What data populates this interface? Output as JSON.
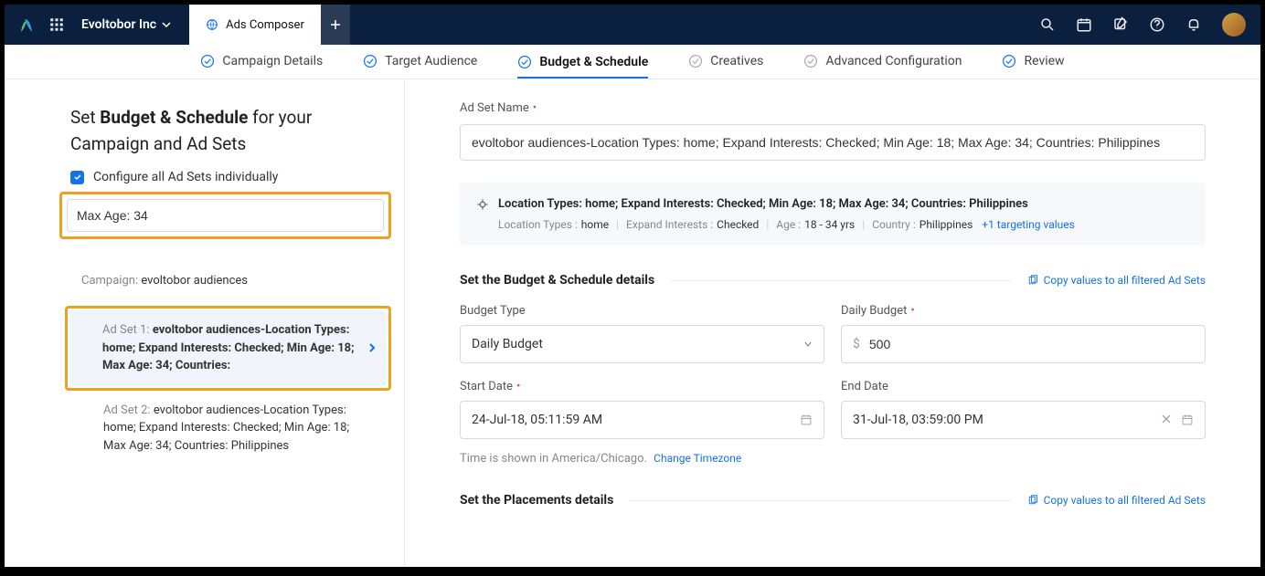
{
  "topnav": {
    "org": "Evoltobor Inc",
    "tab_label": "Ads Composer"
  },
  "steps": [
    "Campaign Details",
    "Target Audience",
    "Budget & Schedule",
    "Creatives",
    "Advanced Configuration",
    "Review"
  ],
  "sidebar": {
    "title_pre": "Set ",
    "title_strong": "Budget & Schedule",
    "title_post": " for your Campaign and Ad Sets",
    "configure_label": "Configure all Ad Sets individually",
    "filter_value": "Max Age: 34",
    "campaign_label": "Campaign: ",
    "campaign_name": "evoltobor audiences",
    "adset1_prefix": "Ad Set 1: ",
    "adset1_name": "evoltobor audiences-Location Types: home; Expand Interests: Checked; Min Age: 18; Max Age: 34; Countries:",
    "adset2_prefix": "Ad Set 2: ",
    "adset2_name": "evoltobor audiences-Location Types: home; Expand Interests: Checked; Min Age: 18; Max Age: 34; Countries: Philippines"
  },
  "main": {
    "adset_name_label": "Ad Set Name",
    "adset_name_value": "evoltobor audiences-Location Types: home; Expand Interests: Checked; Min Age: 18; Max Age: 34; Countries: Philippines",
    "summary_title": "Location Types: home; Expand Interests: Checked; Min Age: 18; Max Age: 34; Countries: Philippines",
    "meta_loc_lbl": "Location Types :",
    "meta_loc_val": "home",
    "meta_exp_lbl": "Expand Interests :",
    "meta_exp_val": "Checked",
    "meta_age_lbl": "Age :",
    "meta_age_val": "18 - 34 yrs",
    "meta_ctry_lbl": "Country :",
    "meta_ctry_val": "Philippines",
    "meta_more": "+1 targeting values",
    "section1_title": "Set the Budget & Schedule details",
    "copy_link": "Copy values to all filtered Ad Sets",
    "budget_type_label": "Budget Type",
    "budget_type_value": "Daily Budget",
    "daily_budget_label": "Daily Budget",
    "daily_budget_value": "500",
    "currency": "$",
    "start_date_label": "Start Date",
    "start_date_value": "24-Jul-18, 05:11:59 AM",
    "end_date_label": "End Date",
    "end_date_value": "31-Jul-18, 03:59:00 PM",
    "tz_text": "Time is shown in America/Chicago.",
    "tz_link": "Change Timezone",
    "section2_title": "Set the Placements details"
  }
}
